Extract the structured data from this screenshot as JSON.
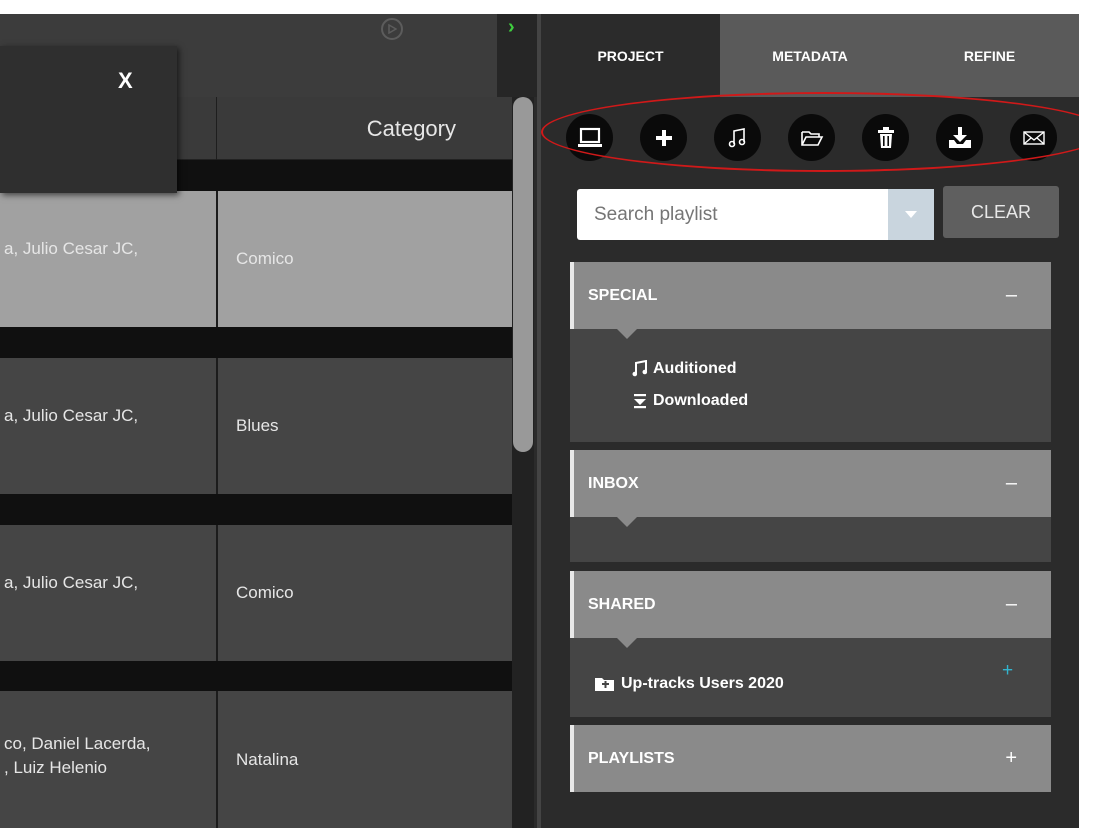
{
  "left_panel": {
    "popup": {
      "close_label": "X"
    },
    "columns": {
      "category": "Category"
    },
    "rows": [
      {
        "artist": "a, Julio Cesar JC,",
        "category": "Comico",
        "selected": true
      },
      {
        "artist": "a, Julio Cesar JC,",
        "category": "Blues",
        "selected": false
      },
      {
        "artist": "a, Julio Cesar JC,",
        "category": "Comico",
        "selected": false
      },
      {
        "artist": "co, Daniel Lacerda,\n, Luiz Helenio",
        "category": "Natalina",
        "selected": false
      }
    ],
    "expand_chevron": "›"
  },
  "right_panel": {
    "tabs": [
      {
        "label": "PROJECT",
        "active": true
      },
      {
        "label": "METADATA",
        "active": false
      },
      {
        "label": "REFINE",
        "active": false
      }
    ],
    "toolbar_icons": [
      "laptop-icon",
      "plus-icon",
      "music-note-icon",
      "folder-open-icon",
      "trash-icon",
      "download-icon",
      "mail-icon"
    ],
    "search": {
      "placeholder": "Search playlist",
      "value": ""
    },
    "clear_label": "CLEAR",
    "sections": {
      "special": {
        "title": "SPECIAL",
        "toggle": "–",
        "items": [
          "Auditioned",
          "Downloaded"
        ]
      },
      "inbox": {
        "title": "INBOX",
        "toggle": "–"
      },
      "shared": {
        "title": "SHARED",
        "toggle": "–",
        "items": [
          "Up-tracks Users 2020"
        ],
        "add": "+"
      },
      "playlists": {
        "title": "PLAYLISTS",
        "toggle": "+"
      }
    }
  },
  "colors": {
    "accent_green": "#3fcf3f",
    "annotation_red": "#d01919",
    "add_blue": "#32b4ce"
  }
}
